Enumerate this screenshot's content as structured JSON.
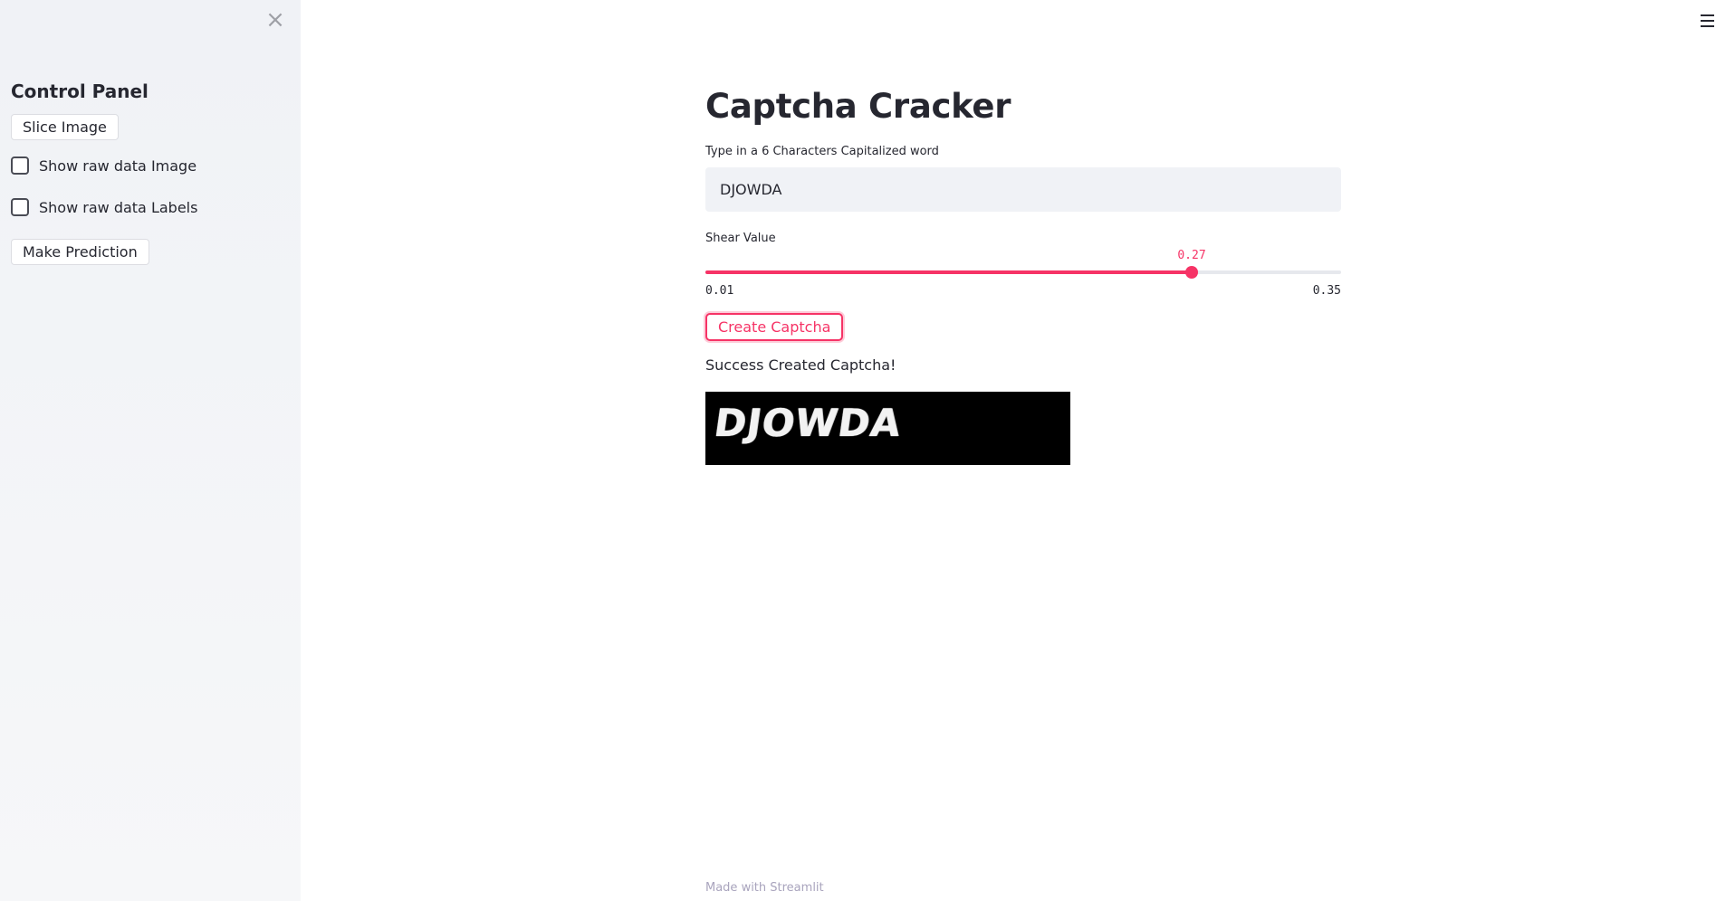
{
  "sidebar": {
    "close_icon": "close-icon",
    "title": "Control Panel",
    "slice_button": "Slice Image",
    "checkboxes": [
      {
        "label": "Show raw data Image",
        "checked": false
      },
      {
        "label": "Show raw data Labels",
        "checked": false
      }
    ],
    "predict_button": "Make Prediction"
  },
  "header": {
    "menu_icon": "hamburger-menu-icon"
  },
  "main": {
    "title": "Captcha Cracker",
    "word_input": {
      "label": "Type in a 6 Characters Capitalized word",
      "value": "DJOWDA"
    },
    "shear_slider": {
      "label": "Shear Value",
      "min": 0.01,
      "max": 0.35,
      "value": 0.27,
      "min_label": "0.01",
      "max_label": "0.35",
      "value_label": "0.27"
    },
    "create_button": "Create Captcha",
    "success_message": "Success Created Captcha!",
    "captcha_image_text": "DJOWDA"
  },
  "footer": {
    "text": "Made with Streamlit"
  },
  "colors": {
    "accent": "#f63366",
    "sidebar_bg": "#f0f2f6",
    "input_bg": "#f0f2f6",
    "text": "#262730"
  }
}
